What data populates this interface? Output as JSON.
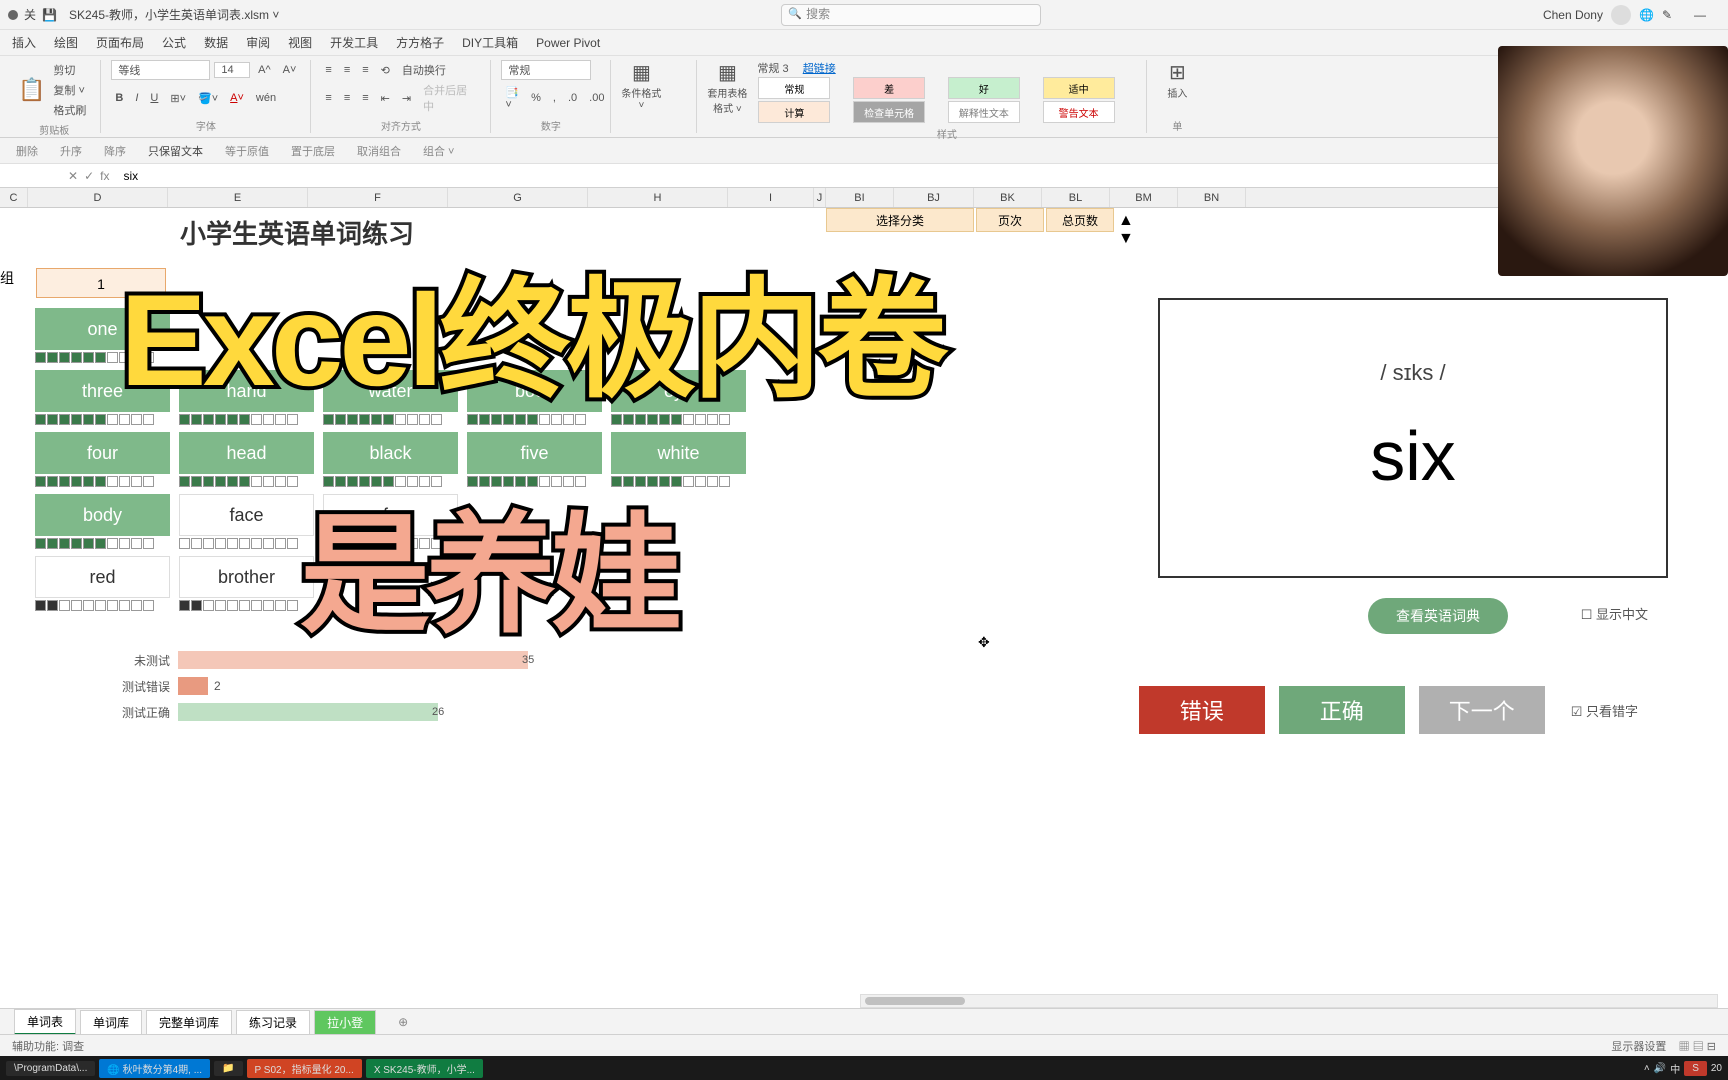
{
  "title_bar": {
    "filename": "SK245-教师，小学生英语单词表.xlsm ˅",
    "search_placeholder": "搜索",
    "user_name": "Chen Dony"
  },
  "ribbon_tabs": [
    "插入",
    "绘图",
    "页面布局",
    "公式",
    "数据",
    "审阅",
    "视图",
    "开发工具",
    "方方格子",
    "DIY工具箱",
    "Power Pivot"
  ],
  "clipboard": {
    "cut": "剪切",
    "copy": "复制 ˅",
    "brush": "格式刷",
    "title": "剪贴板"
  },
  "font": {
    "name": "等线",
    "size": "14",
    "title": "字体"
  },
  "align": {
    "wrap": "自动换行",
    "merge": "合并后居中",
    "title": "对齐方式"
  },
  "number": {
    "format": "常规",
    "title": "数字"
  },
  "styles": {
    "cond": "条件格式 ˅",
    "table": "套用表格格式 ˅",
    "row1": "常规 3",
    "row1b": "超链接",
    "swatches": [
      {
        "t": "常规",
        "bg": "#fff"
      },
      {
        "t": "差",
        "bg": "#fccfcc"
      },
      {
        "t": "好",
        "bg": "#c6efce"
      },
      {
        "t": "适中",
        "bg": "#ffeb9c"
      },
      {
        "t": "计算",
        "bg": "#fde9d9"
      },
      {
        "t": "检查单元格",
        "bg": "#a5a5a5",
        "c": "#fff"
      },
      {
        "t": "解释性文本",
        "bg": "#fff",
        "c": "#7f7f7f"
      },
      {
        "t": "警告文本",
        "bg": "#fff",
        "c": "#c00"
      }
    ],
    "title": "样式"
  },
  "cells": {
    "insert": "插入",
    "title": "单"
  },
  "sec_bar": [
    "删除",
    "升序",
    "降序",
    "只保留文本",
    "等于原值",
    "置于底层",
    "取消组合",
    "组合 ˅"
  ],
  "formula": {
    "cell_value": "six",
    "fx": "fx"
  },
  "columns": [
    "C",
    "D",
    "E",
    "F",
    "G",
    "H",
    "I",
    "J",
    "BI",
    "BJ",
    "BK",
    "BL",
    "BM",
    "BN"
  ],
  "worksheet": {
    "title": "小学生英语单词练习",
    "cat_label": "组",
    "indices": [
      "1"
    ],
    "opt_headers": [
      {
        "t": "选择分类",
        "col": "BJ"
      },
      {
        "t": "页次",
        "col": "BL"
      },
      {
        "t": "总页数",
        "col": "BM"
      }
    ],
    "words": [
      [
        {
          "t": "one",
          "g": 1
        }
      ],
      [
        {
          "t": "three",
          "g": 1
        },
        {
          "t": "hand",
          "g": 1
        },
        {
          "t": "water",
          "g": 1
        },
        {
          "t": "book",
          "g": 1
        },
        {
          "t": "eye",
          "g": 1
        }
      ],
      [
        {
          "t": "four",
          "g": 1
        },
        {
          "t": "head",
          "g": 1
        },
        {
          "t": "black",
          "g": 1
        },
        {
          "t": "five",
          "g": 1
        },
        {
          "t": "white",
          "g": 1
        }
      ],
      [
        {
          "t": "body",
          "g": 1
        },
        {
          "t": "face",
          "g": 0
        },
        {
          "t": "fo",
          "g": 0
        }
      ],
      [
        {
          "t": "red",
          "g": 0
        },
        {
          "t": "brother",
          "g": 0
        }
      ]
    ],
    "card": {
      "phonetic": "/ sɪks /",
      "word": "six"
    },
    "btn_dict": "查看英语词典",
    "chk_cn": "显示中文",
    "stats": {
      "untested": {
        "label": "未测试",
        "val": "35"
      },
      "wrong": {
        "label": "测试错误",
        "val": "2"
      },
      "correct": {
        "label": "测试正确",
        "val": "26"
      }
    },
    "buttons": {
      "err": "错误",
      "ok": "正确",
      "next": "下一个"
    },
    "chk_only_err": "只看错字"
  },
  "sheet_tabs": [
    "单词表",
    "单词库",
    "完整单词库",
    "练习记录",
    "拉小登"
  ],
  "status": {
    "left": "辅助功能: 调查",
    "disp": "显示器设置"
  },
  "taskbar": {
    "items": [
      "\\ProgramData\\...",
      "秋叶数分第4期, ...",
      "S02，指标量化 20...",
      "SK245-教师，小学..."
    ],
    "ime": "中"
  },
  "overlay": {
    "line1": "Excel终极内卷",
    "line2": "是养娃"
  }
}
